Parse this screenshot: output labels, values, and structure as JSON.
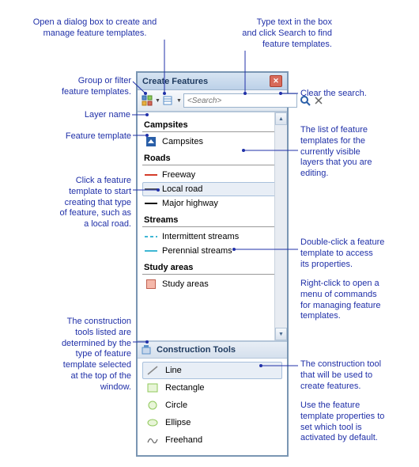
{
  "panel": {
    "title": "Create Features",
    "search_placeholder": "<Search>"
  },
  "layers": [
    {
      "name": "Campsites",
      "templates": [
        {
          "label": "Campsites",
          "sym": "point",
          "color": "#2a5fa8"
        }
      ]
    },
    {
      "name": "Roads",
      "templates": [
        {
          "label": "Freeway",
          "sym": "line",
          "color": "#d43c2a"
        },
        {
          "label": "Local road",
          "sym": "line",
          "color": "#555555",
          "selected": true
        },
        {
          "label": "Major highway",
          "sym": "line",
          "color": "#111111"
        }
      ]
    },
    {
      "name": "Streams",
      "templates": [
        {
          "label": "Intermittent streams",
          "sym": "dash",
          "color": "#3fb7d4"
        },
        {
          "label": "Perennial streams",
          "sym": "line",
          "color": "#3fb7d4"
        }
      ]
    },
    {
      "name": "Study areas",
      "templates": [
        {
          "label": "Study areas",
          "sym": "square",
          "color": "#f5b8aa"
        }
      ]
    }
  ],
  "construction": {
    "title": "Construction Tools",
    "tools": [
      {
        "label": "Line",
        "shape": "line",
        "selected": true
      },
      {
        "label": "Rectangle",
        "shape": "rect"
      },
      {
        "label": "Circle",
        "shape": "circle"
      },
      {
        "label": "Ellipse",
        "shape": "ellipse"
      },
      {
        "label": "Freehand",
        "shape": "freehand"
      }
    ]
  },
  "annotations": {
    "a1": "Open a dialog box to create and\nmanage feature templates.",
    "a2": "Type text in the box\nand click Search to find\nfeature templates.",
    "a3": "Group or filter\nfeature templates.",
    "a4": "Clear the search.",
    "a5": "Layer name",
    "a6": "Feature template",
    "a7": "Click a feature\ntemplate to start\ncreating that type\nof feature, such as\na local road.",
    "a8": "The list of feature\ntemplates for the\ncurrently visible\nlayers that you are\nediting.",
    "a9": "Double-click a feature\ntemplate to access\nits properties.",
    "a10": "Right-click to open a\nmenu of commands\nfor managing feature\ntemplates.",
    "a11": "The construction\ntools listed are\ndetermined by the\ntype of feature\ntemplate selected\nat the top of the\nwindow.",
    "a12": "The construction tool\nthat will be used to\ncreate features.",
    "a13": "Use the feature\ntemplate properties to\nset which tool is\nactivated by default."
  }
}
